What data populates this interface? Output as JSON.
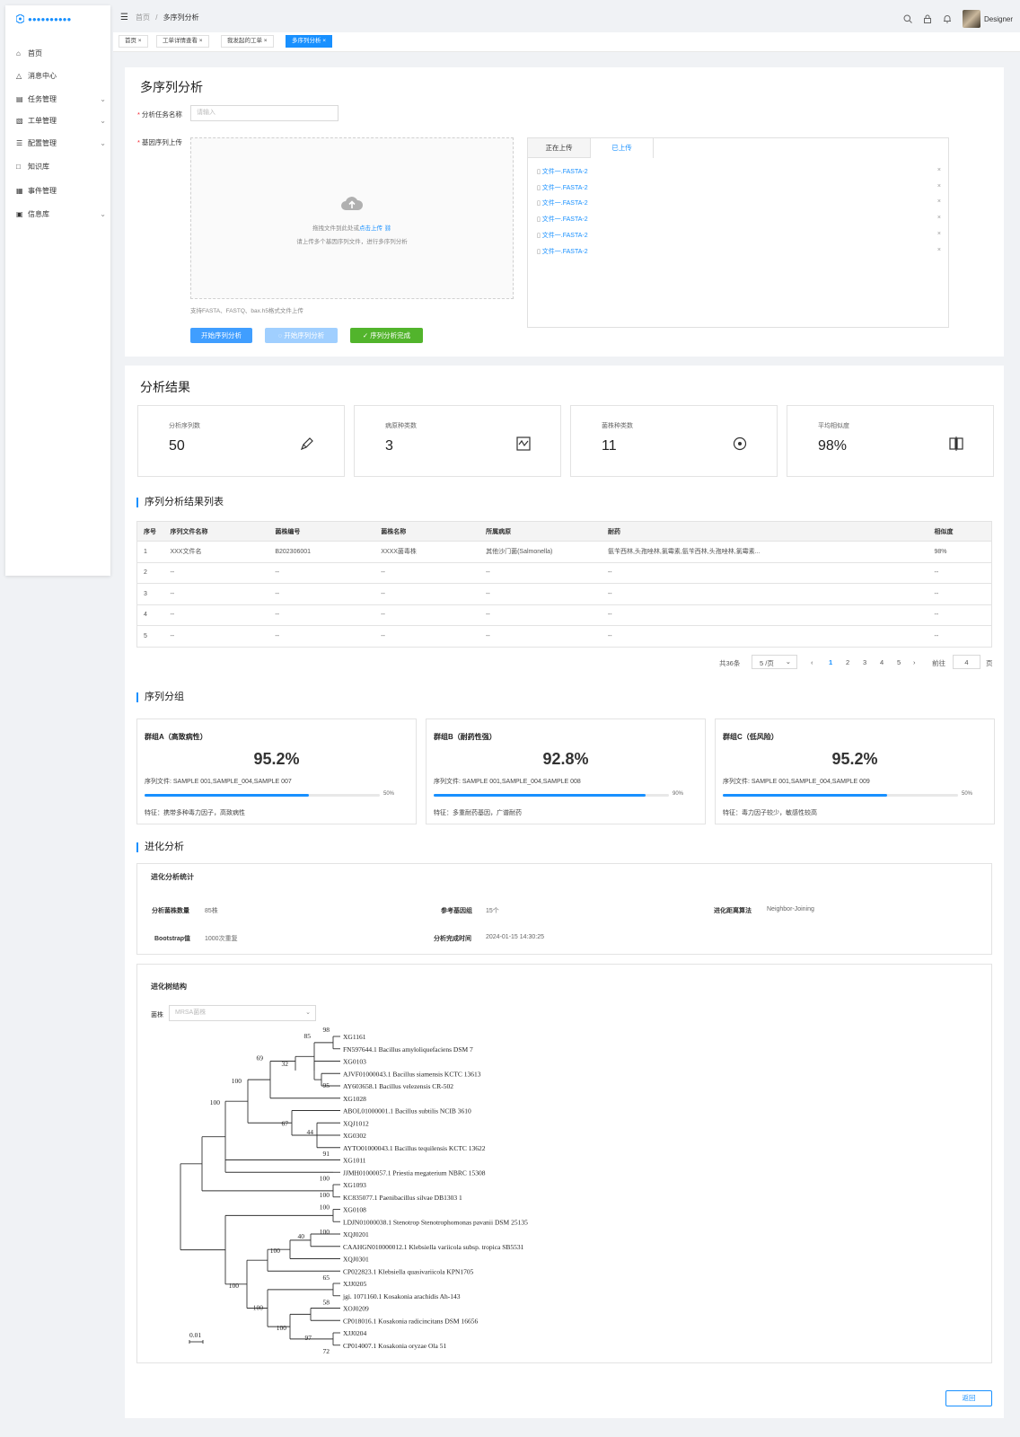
{
  "sidebar": {
    "logo": "●●●●●●●●●●",
    "items": [
      {
        "label": "首页",
        "icon": "home-icon"
      },
      {
        "label": "消息中心",
        "icon": "bell-icon"
      },
      {
        "label": "任务管理",
        "icon": "document-icon",
        "expand": true
      },
      {
        "label": "工单管理",
        "icon": "ticket-icon",
        "expand": true
      },
      {
        "label": "配置管理",
        "icon": "sliders-icon",
        "expand": true
      },
      {
        "label": "知识库",
        "icon": "book-icon"
      },
      {
        "label": "事件管理",
        "icon": "calendar-icon"
      },
      {
        "label": "信息库",
        "icon": "info-board-icon",
        "expand": true
      }
    ]
  },
  "header": {
    "breadcrumb_home": "首页",
    "breadcrumb_sep": "/",
    "breadcrumb_current": "多序列分析",
    "user": "Designer"
  },
  "tabs": [
    "首页",
    "工单详情查看",
    "我发起的工单",
    "多序列分析"
  ],
  "form": {
    "title": "多序列分析",
    "task_name_label": "分析任务名称",
    "task_name_placeholder": "请输入",
    "upload_label": "基因序列上传",
    "drop_text_1": "拖拽文件到此处或",
    "drop_text_link": "点击上传",
    "drop_text_2": "请上传多个基因序列文件，进行多序列分析",
    "support_text": "支持FASTA、FASTQ、bax.h5格式文件上传",
    "btn_start": "开始序列分析",
    "btn_running": "开始序列分析",
    "btn_done": "序列分析完成",
    "upload_tabs": [
      "正在上传",
      "已上传"
    ],
    "files": [
      "文件一.FASTA-2",
      "文件一.FASTA-2",
      "文件一.FASTA-2",
      "文件一.FASTA-2",
      "文件一.FASTA-2",
      "文件一.FASTA-2"
    ]
  },
  "results": {
    "title": "分析结果",
    "stats": [
      {
        "label": "分析序列数",
        "value": "50",
        "icon": "pen-icon"
      },
      {
        "label": "病原种类数",
        "value": "3",
        "icon": "chart-box-icon"
      },
      {
        "label": "菌株种类数",
        "value": "11",
        "icon": "target-icon"
      },
      {
        "label": "平均相似度",
        "value": "98%",
        "icon": "compare-icon"
      }
    ],
    "list_title": "序列分析结果列表",
    "columns": [
      "序号",
      "序列文件名称",
      "菌株编号",
      "菌株名称",
      "所属病原",
      "耐药",
      "相似度"
    ],
    "rows": [
      [
        "1",
        "XXX文件名",
        "B202306001",
        "XXXX菌毒株",
        "其他沙门菌(Salmonella)",
        "氨苄西林,头孢唑林,氯霉素,氨苄西林,头孢唑林,氯霉素...",
        "98%"
      ],
      [
        "2",
        "--",
        "--",
        "--",
        "--",
        "--",
        "--"
      ],
      [
        "3",
        "--",
        "--",
        "--",
        "--",
        "--",
        "--"
      ],
      [
        "4",
        "--",
        "--",
        "--",
        "--",
        "--",
        "--"
      ],
      [
        "5",
        "--",
        "--",
        "--",
        "--",
        "--",
        "--"
      ]
    ],
    "pager": {
      "total": "共36条",
      "size": "5 /页",
      "pages": [
        "1",
        "2",
        "3",
        "4",
        "5"
      ],
      "goto": "前往",
      "goto_value": "4",
      "page_unit": "页"
    }
  },
  "groups": {
    "title": "序列分组",
    "items": [
      {
        "name": "群组A（高致病性）",
        "percent": "95.2%",
        "files": "序列文件: SAMPLE 001,SAMPLE_004,SAMPLE 007",
        "progress": 0.7,
        "progress_label": "50%",
        "feature": "特征：携带多种毒力因子，高致病性"
      },
      {
        "name": "群组B（耐药性强）",
        "percent": "92.8%",
        "files": "序列文件: SAMPLE 001,SAMPLE_004,SAMPLE 008",
        "progress": 0.9,
        "progress_label": "90%",
        "feature": "特征：多重耐药基因，广谱耐药"
      },
      {
        "name": "群组C（低风险）",
        "percent": "95.2%",
        "files": "序列文件: SAMPLE 001,SAMPLE_004,SAMPLE 009",
        "progress": 0.7,
        "progress_label": "50%",
        "feature": "特征：毒力因子较少，敏感性较高"
      }
    ]
  },
  "evolution": {
    "title": "进化分析",
    "stats_title": "进化分析统计",
    "stats": [
      {
        "k": "分析菌株数量",
        "v": "85株"
      },
      {
        "k": "参考基因组",
        "v": "15个"
      },
      {
        "k": "进化距离算法",
        "v": "Neighbor-Joining"
      },
      {
        "k": "Bootstrap值",
        "v": "1000次重复"
      },
      {
        "k": "分析完成时间",
        "v": "2024-01-15 14:30:25"
      }
    ],
    "tree_title": "进化树结构",
    "strain_label": "菌株",
    "strain_value": "MRSA菌株",
    "scale": "0.01",
    "leaves": [
      "XG1161",
      "FN597644.1 Bacillus amyloliquefaciens DSM 7",
      "XG0103",
      "AJVF01000043.1 Bacillus siamensis KCTC 13613",
      "AY603658.1 Bacillus velezensis CR-502",
      "XG1028",
      "ABOL01000001.1 Bacillus subtilis NCIB 3610",
      "XQJ1012",
      "XG0302",
      "AYTO01000043.1 Bacillus tequilensis KCTC 13622",
      "XG1011",
      "JJMH01000057.1 Priestia megaterium NBRC 15308",
      "XG1093",
      "KC835077.1 Paenibacillus silvae DB1303 1",
      "XG0108",
      "LDJN01000038.1 Stenotrop Stenotrophomonas pavanii DSM 25135",
      "XQJ0201",
      "CAAHGN010000012.1 Klebsiella variicola subsp. tropica SB5531",
      "XQJ0301",
      "CP022823.1 Klebsiella quasivariicola KPN1705",
      "XJJ0205",
      "jgi. 1071160.1 Kosakonia arachidis Ah-143",
      "XOJ0209",
      "CP018016.1 Kosakonia radicincitans DSM 16656",
      "XJJ0204",
      "CP014007.1 Kosakonia oryzae Ola 51"
    ],
    "bootstrap": [
      "98",
      "85",
      "32",
      "95",
      "69",
      "100",
      "100",
      "67",
      "44",
      "91",
      "100",
      "100",
      "100",
      "100",
      "40",
      "100",
      "100",
      "65",
      "100",
      "58",
      "100",
      "97",
      "72"
    ]
  },
  "back_button": "返回"
}
